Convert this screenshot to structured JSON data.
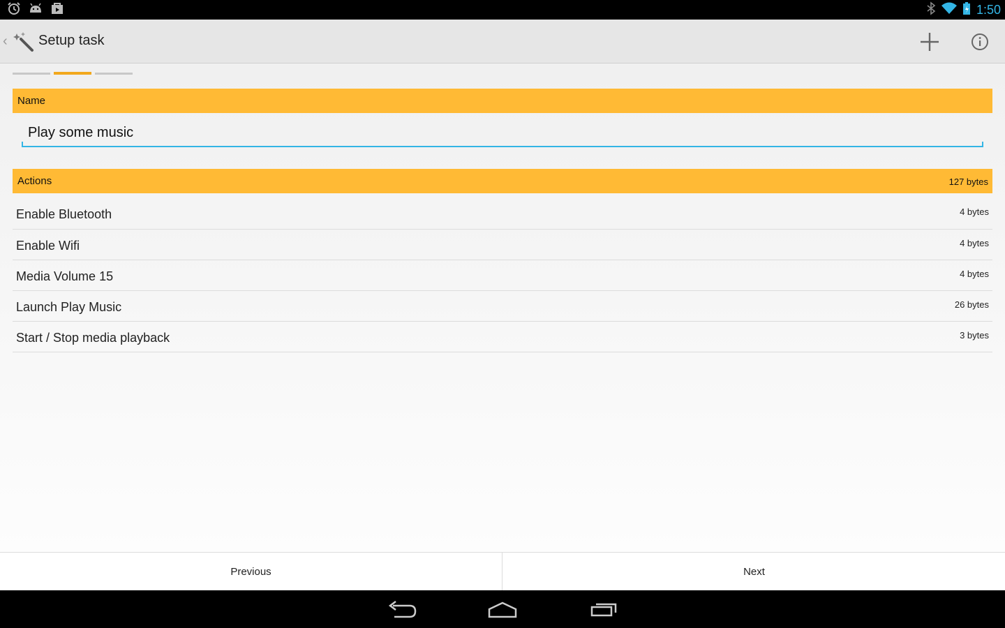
{
  "status_bar": {
    "time": "1:50",
    "left_icons": [
      "alarm-icon",
      "android-icon",
      "shopping-bag-icon"
    ],
    "right_icons": [
      "bluetooth-icon",
      "wifi-icon",
      "battery-charging-icon"
    ]
  },
  "action_bar": {
    "title": "Setup task",
    "app_icon": "magic-wand-icon",
    "actions": [
      "add-icon",
      "info-icon"
    ]
  },
  "wizard_steps": {
    "count": 3,
    "active_index": 1
  },
  "name_section": {
    "header": "Name",
    "value": "Play some music"
  },
  "actions_section": {
    "header": "Actions",
    "total_size": "127 bytes",
    "items": [
      {
        "name": "Enable Bluetooth",
        "size": "4 bytes"
      },
      {
        "name": "Enable Wifi",
        "size": "4 bytes"
      },
      {
        "name": "Media Volume 15",
        "size": "4 bytes"
      },
      {
        "name": "Launch Play Music",
        "size": "26 bytes"
      },
      {
        "name": "Start / Stop media playback",
        "size": "3 bytes"
      }
    ]
  },
  "bottom_buttons": {
    "previous": "Previous",
    "next": "Next"
  },
  "colors": {
    "accent": "#33b5e5",
    "header_bar": "#ffba35",
    "step_active": "#f2a81d"
  }
}
